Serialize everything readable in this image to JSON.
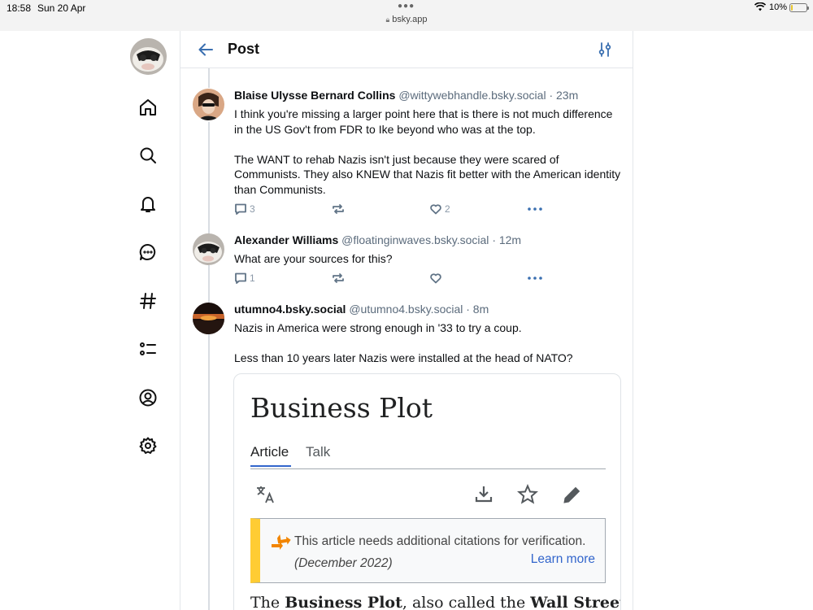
{
  "status_bar": {
    "time": "18:58",
    "date": "Sun 20 Apr",
    "url": "bsky.app",
    "battery": "10%",
    "battery_level": 0.1
  },
  "header": {
    "title": "Post",
    "back_icon": "arrow-left-icon",
    "filter_icon": "sliders-icon"
  },
  "nav": {
    "items": [
      "home-icon",
      "search-icon",
      "bell-icon",
      "chat-icon",
      "hashtag-icon",
      "list-icon",
      "profile-icon",
      "gear-icon"
    ]
  },
  "posts": [
    {
      "name": "Blaise Ulysse Bernard Collins",
      "handle": "@wittywebhandle.bsky.social",
      "time": "· 23m",
      "paragraphs": [
        "I think you're missing a larger point here that is there is not much difference in the US Gov't from FDR to Ike beyond who was at the top.",
        "The WANT to rehab Nazis isn't just because they were scared of Communists. They also KNEW that Nazis fit better with the American identity than Communists."
      ],
      "replies": "3",
      "reposts": "",
      "likes": "2"
    },
    {
      "name": "Alexander Williams",
      "handle": "@floatinginwaves.bsky.social",
      "time": "· 12m",
      "paragraphs": [
        "What are your sources for this?"
      ],
      "replies": "1",
      "reposts": "",
      "likes": ""
    },
    {
      "name": "utumno4.bsky.social",
      "handle": "@utumno4.bsky.social",
      "time": "· 8m",
      "paragraphs": [
        "Nazis in America were strong enough in '33 to try a coup.",
        "Less than 10 years later Nazis were installed at the head of NATO?"
      ]
    }
  ],
  "embed": {
    "title": "Business Plot",
    "tabs": [
      "Article",
      "Talk"
    ],
    "notice_text": "This article needs additional citations for verification.",
    "notice_date": "(December 2022)",
    "notice_link": "Learn more",
    "body_1": "The ",
    "body_bold_1": "Business Plot",
    "body_2": ", also called the ",
    "body_bold_2": "Wall Street",
    "colors": {
      "accent": "#3366cc",
      "notice_bar": "#ffcc33",
      "notice_icon": "#f28500"
    }
  }
}
